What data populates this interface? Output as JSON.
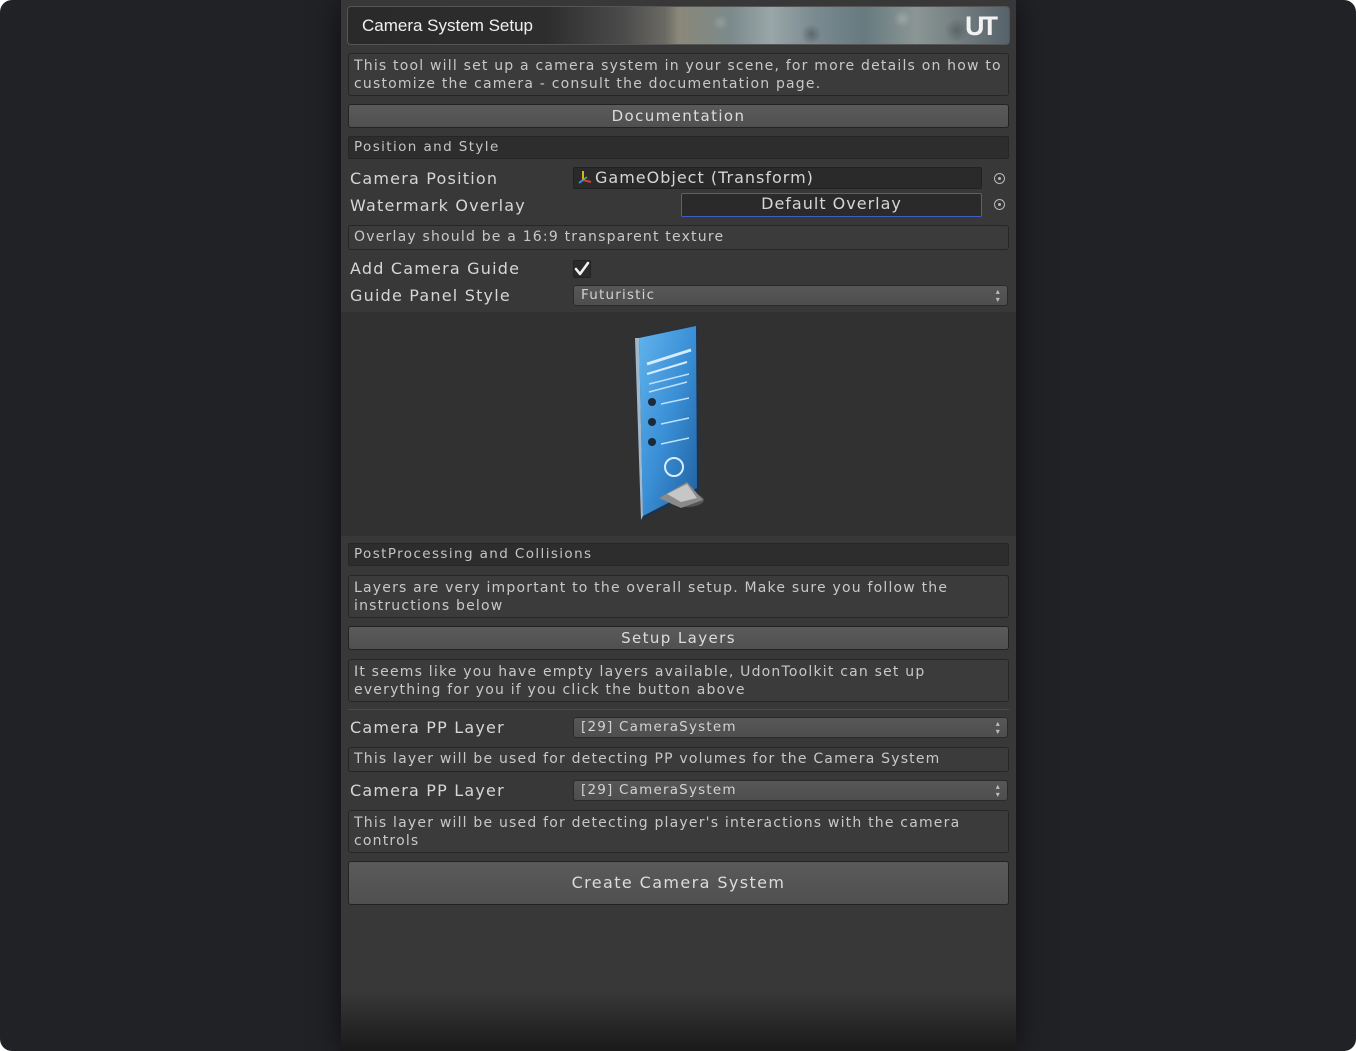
{
  "window": {
    "title": "Camera System Setup",
    "logo": "UT"
  },
  "intro": {
    "text": "This tool will set up a camera system in your scene, for more details on how to customize the camera - consult the documentation page."
  },
  "buttons": {
    "documentation": "Documentation",
    "setup_layers": "Setup Layers",
    "create": "Create Camera System"
  },
  "position_style": {
    "header": "Position and Style",
    "camera_position_label": "Camera Position",
    "camera_position_value": "GameObject (Transform)",
    "watermark_label": "Watermark Overlay",
    "watermark_value": "Default Overlay",
    "overlay_hint": "Overlay should be a 16:9 transparent texture",
    "add_guide_label": "Add Camera Guide",
    "add_guide_checked": true,
    "guide_style_label": "Guide Panel Style",
    "guide_style_value": "Futuristic"
  },
  "post_processing": {
    "header": "PostProcessing and Collisions",
    "layers_note": "Layers are very important to the overall setup. Make sure you follow the instructions below",
    "empty_layers_note": "It seems like you have empty layers available, UdonToolkit can set up everything for you if you click the button above",
    "pp_layer_label": "Camera PP Layer",
    "pp_layer_value": "[29] CameraSystem",
    "pp_layer_hint": "This layer will be used for detecting PP volumes for the Camera System",
    "interact_layer_label": "Camera PP Layer",
    "interact_layer_value": "[29] CameraSystem",
    "interact_layer_hint": "This layer will be used for detecting player's interactions with the camera controls"
  },
  "icons": {
    "transform": "transform-axes-icon",
    "object_picker": "object-picker-icon",
    "checkbox": "checkmark-icon",
    "dropdown": "dropdown-arrows-icon"
  },
  "colors": {
    "window_bg": "#383838",
    "outer_bg": "#212226",
    "highlight_border": "#3e5fbf",
    "guide_panel_blue": "#3a8fd6"
  }
}
